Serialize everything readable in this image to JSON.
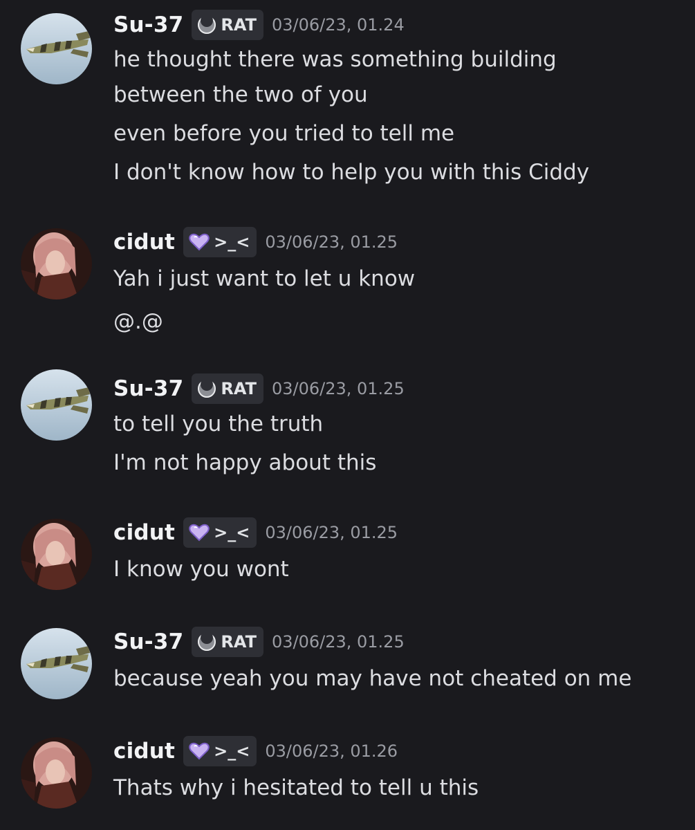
{
  "messages": [
    {
      "user": "Su-37",
      "avatar": "jet-avatar",
      "tag_icon": "crescent-moon-icon",
      "tag": "RAT",
      "timestamp": "03/06/23, 01.24",
      "lines": [
        "he thought there was something building",
        "between the two of you",
        "even before you tried to tell me",
        "I don't know how to help you with this Ciddy"
      ]
    },
    {
      "user": "cidut",
      "avatar": "pink-hair-avatar",
      "tag_icon": "purple-heart-icon",
      "tag": ">_<",
      "timestamp": "03/06/23, 01.25",
      "lines": [
        "Yah i just want to let u know",
        "@.@"
      ]
    },
    {
      "user": "Su-37",
      "avatar": "jet-avatar",
      "tag_icon": "crescent-moon-icon",
      "tag": "RAT",
      "timestamp": "03/06/23, 01.25",
      "lines": [
        "to tell you the truth",
        "I'm not happy about this"
      ]
    },
    {
      "user": "cidut",
      "avatar": "pink-hair-avatar",
      "tag_icon": "purple-heart-icon",
      "tag": ">_<",
      "timestamp": "03/06/23, 01.25",
      "lines": [
        "I know you wont"
      ]
    },
    {
      "user": "Su-37",
      "avatar": "jet-avatar",
      "tag_icon": "crescent-moon-icon",
      "tag": "RAT",
      "timestamp": "03/06/23, 01.25",
      "lines": [
        "because yeah you may have not cheated on me"
      ]
    },
    {
      "user": "cidut",
      "avatar": "pink-hair-avatar",
      "tag_icon": "purple-heart-icon",
      "tag": ">_<",
      "timestamp": "03/06/23, 01.26",
      "lines": [
        "Thats why i hesitated to tell u this"
      ]
    }
  ],
  "colors": {
    "background": "#1a1a1e",
    "username": "#f2f3f5",
    "message_text": "#dcdde1",
    "timestamp": "#9a9ca3",
    "tag_background": "#2e2f35"
  }
}
